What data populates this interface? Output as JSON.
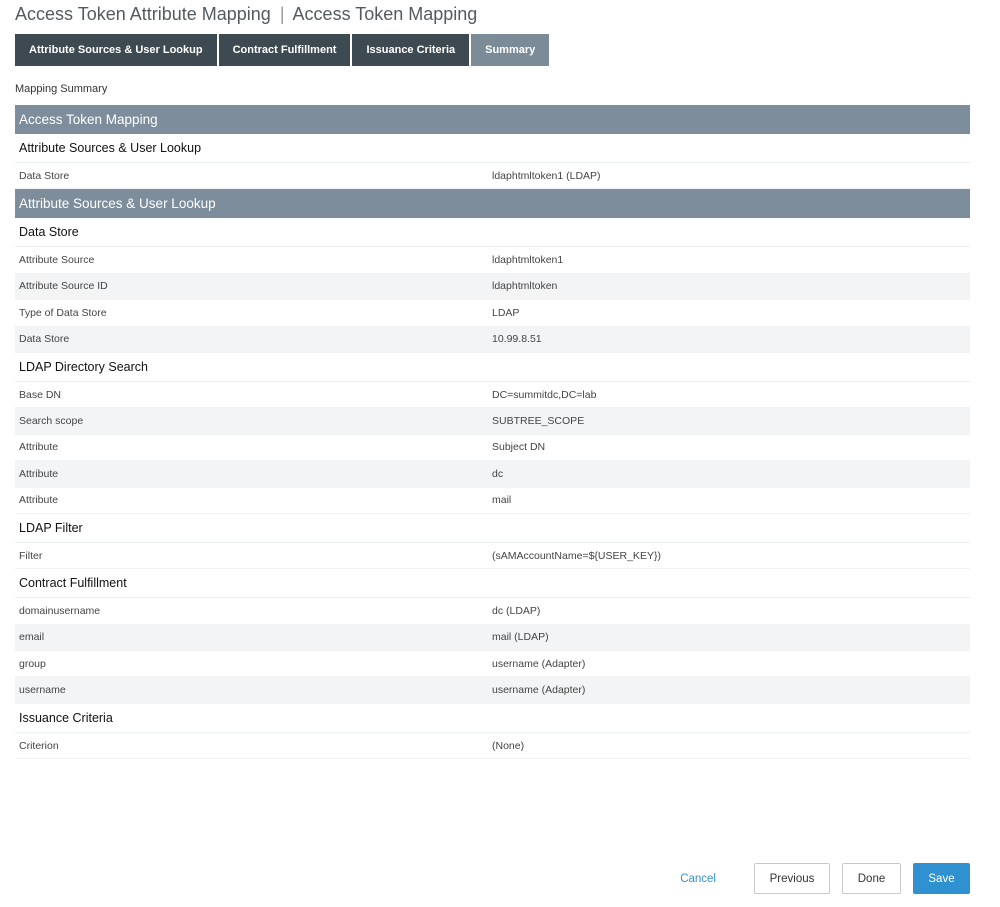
{
  "title": {
    "main": "Access Token Attribute Mapping",
    "separator": "|",
    "sub": "Access Token Mapping"
  },
  "tabs": [
    {
      "label": "Attribute Sources & User Lookup"
    },
    {
      "label": "Contract Fulfillment"
    },
    {
      "label": "Issuance Criteria"
    },
    {
      "label": "Summary",
      "active": true
    }
  ],
  "summary_label": "Mapping Summary",
  "sections": [
    {
      "header": "Access Token Mapping",
      "groups": [
        {
          "title": "Attribute Sources & User Lookup",
          "rows": [
            {
              "key": "Data Store",
              "value": "ldaphtmltoken1 (LDAP)"
            }
          ]
        }
      ]
    },
    {
      "header": "Attribute Sources & User Lookup",
      "groups": [
        {
          "title": "Data Store",
          "rows": [
            {
              "key": "Attribute Source",
              "value": "ldaphtmltoken1"
            },
            {
              "key": "Attribute Source ID",
              "value": "ldaphtmltoken"
            },
            {
              "key": "Type of Data Store",
              "value": "LDAP"
            },
            {
              "key": "Data Store",
              "value": "10.99.8.51"
            }
          ]
        },
        {
          "title": "LDAP Directory Search",
          "rows": [
            {
              "key": "Base DN",
              "value": "DC=summitdc,DC=lab"
            },
            {
              "key": "Search scope",
              "value": "SUBTREE_SCOPE"
            },
            {
              "key": "Attribute",
              "value": "Subject DN"
            },
            {
              "key": "Attribute",
              "value": "dc"
            },
            {
              "key": "Attribute",
              "value": "mail"
            }
          ]
        },
        {
          "title": "LDAP Filter",
          "rows": [
            {
              "key": "Filter",
              "value": "(sAMAccountName=${USER_KEY})"
            }
          ]
        },
        {
          "title": "Contract Fulfillment",
          "rows": [
            {
              "key": "domainusername",
              "value": "dc (LDAP)"
            },
            {
              "key": "email",
              "value": "mail (LDAP)"
            },
            {
              "key": "group",
              "value": "username (Adapter)"
            },
            {
              "key": "username",
              "value": "username (Adapter)"
            }
          ]
        },
        {
          "title": "Issuance Criteria",
          "rows": [
            {
              "key": "Criterion",
              "value": "(None)"
            }
          ]
        }
      ]
    }
  ],
  "footer": {
    "cancel": "Cancel",
    "previous": "Previous",
    "done": "Done",
    "save": "Save"
  }
}
